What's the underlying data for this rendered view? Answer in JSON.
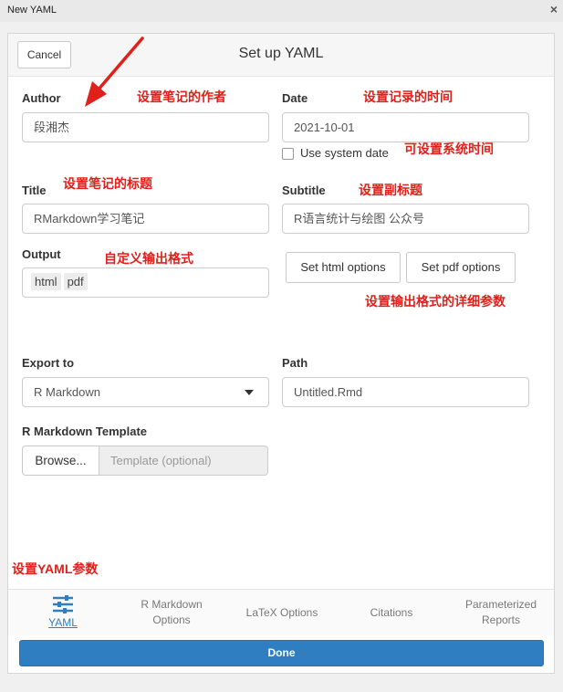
{
  "window": {
    "title": "New YAML",
    "close_glyph": "×"
  },
  "dialog": {
    "title": "Set up YAML",
    "cancel_label": "Cancel",
    "done_label": "Done"
  },
  "form": {
    "author": {
      "label": "Author",
      "value": "段湘杰"
    },
    "date": {
      "label": "Date",
      "value": "2021-10-01",
      "use_system_date_label": "Use system date",
      "use_system_date_checked": false
    },
    "title": {
      "label": "Title",
      "value": "RMarkdown学习笔记"
    },
    "subtitle": {
      "label": "Subtitle",
      "value": "R语言统计与绘图 公众号"
    },
    "output": {
      "label": "Output",
      "formats": [
        "html",
        "pdf"
      ],
      "set_html_label": "Set html options",
      "set_pdf_label": "Set pdf options"
    },
    "export_to": {
      "label": "Export to",
      "value": "R Markdown"
    },
    "path": {
      "label": "Path",
      "value": "Untitled.Rmd"
    },
    "template": {
      "label": "R Markdown Template",
      "browse_label": "Browse...",
      "placeholder": "Template (optional)"
    }
  },
  "tabs": [
    {
      "label": "YAML",
      "active": true,
      "icon": "sliders-icon"
    },
    {
      "label": "R Markdown Options",
      "active": false
    },
    {
      "label": "LaTeX Options",
      "active": false
    },
    {
      "label": "Citations",
      "active": false
    },
    {
      "label": "Parameterized Reports",
      "active": false
    }
  ],
  "annotations": {
    "author": "设置笔记的作者",
    "date": "设置记录的时间",
    "system_date": "可设置系统时间",
    "title": "设置笔记的标题",
    "subtitle": "设置副标题",
    "output": "自定义输出格式",
    "output_options": "设置输出格式的详细参数",
    "yaml": "设置YAML参数"
  },
  "colors": {
    "annotation": "#e0201a",
    "accent": "#2f7ec1",
    "active_tab": "#2f7ec1"
  }
}
